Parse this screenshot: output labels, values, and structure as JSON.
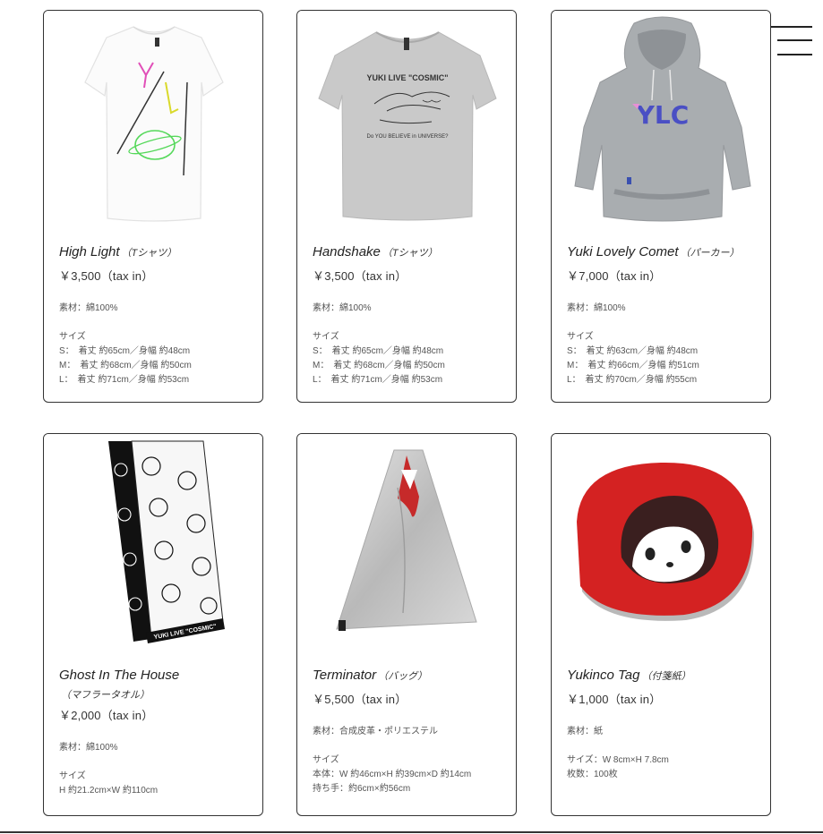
{
  "menu": {
    "icon": "hamburger-menu-icon"
  },
  "products": [
    {
      "name": "High Light",
      "category": "（Tシャツ）",
      "price": "￥3,500（tax in）",
      "material": "素材：綿100%",
      "size_heading": "サイズ",
      "sizes": [
        "S：　着丈 約65cm／身幅 約48cm",
        "M：　着丈 約68cm／身幅 約50cm",
        "L：　着丈 約71cm／身幅 約53cm"
      ],
      "image": "white-tshirt-image"
    },
    {
      "name": "Handshake",
      "category": "（Tシャツ）",
      "price": "￥3,500（tax in）",
      "material": "素材：綿100%",
      "size_heading": "サイズ",
      "sizes": [
        "S：　着丈 約65cm／身幅 約48cm",
        "M：　着丈 約68cm／身幅 約50cm",
        "L：　着丈 約71cm／身幅 約53cm"
      ],
      "image": "gray-tshirt-image",
      "print_text": "YUKI LIVE \"COSMIC\"",
      "print_caption": "Do YOU BELIEVE in UNIVERSE?"
    },
    {
      "name": "Yuki Lovely Comet",
      "category": "（パーカー）",
      "price": "￥7,000（tax in）",
      "material": "素材：綿100%",
      "size_heading": "サイズ",
      "sizes": [
        "S：　着丈 約63cm／身幅 約48cm",
        "M：　着丈 約66cm／身幅 約51cm",
        "L：　着丈 約70cm／身幅 約55cm"
      ],
      "image": "gray-hoodie-image",
      "print_text": "YLC"
    },
    {
      "name": "Ghost In The House",
      "category": "（マフラータオル）",
      "price": "￥2,000（tax in）",
      "material": "素材：綿100%",
      "size_heading": "サイズ",
      "sizes": [
        "H 約21.2cm×W 約110cm"
      ],
      "image": "muffler-towel-image",
      "print_text": "YUKI LIVE \"COSMIC\""
    },
    {
      "name": "Terminator",
      "category": "（バッグ）",
      "price": "￥5,500（tax in）",
      "material": "素材：合成皮革・ポリエステル",
      "size_heading": "サイズ",
      "sizes": [
        "本体：W 約46cm×H 約39cm×D 約14cm",
        "持ち手：約6cm×約56cm"
      ],
      "image": "silver-bag-image"
    },
    {
      "name": "Yukinco Tag",
      "category": "（付箋紙）",
      "price": "￥1,000（tax in）",
      "material": "素材：紙",
      "size_heading": "",
      "sizes": [
        "サイズ：W 8cm×H 7.8cm",
        "枚数：100枚"
      ],
      "image": "sticky-note-image"
    }
  ]
}
